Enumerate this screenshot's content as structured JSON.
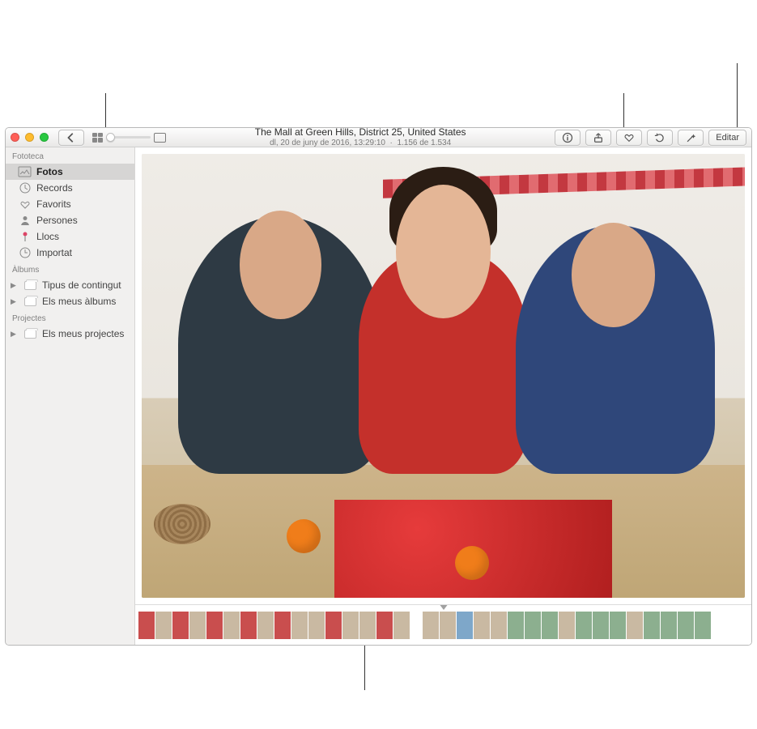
{
  "titlebar": {
    "location_title": "The Mall at Green Hills, District 25, United States",
    "datetime": "dl, 20 de juny de 2016, 13:29:10",
    "position": "1.156 de 1.534",
    "edit_label": "Editar"
  },
  "sidebar": {
    "sections": {
      "library_header": "Fototeca",
      "albums_header": "Àlbums",
      "projects_header": "Projectes"
    },
    "library": {
      "photos": "Fotos",
      "memories": "Records",
      "favorites": "Favorits",
      "people": "Persones",
      "places": "Llocs",
      "imported": "Importat"
    },
    "albums": {
      "content_types": "Tipus de contingut",
      "my_albums": "Els meus àlbums"
    },
    "projects": {
      "my_projects": "Els meus projectes"
    }
  }
}
